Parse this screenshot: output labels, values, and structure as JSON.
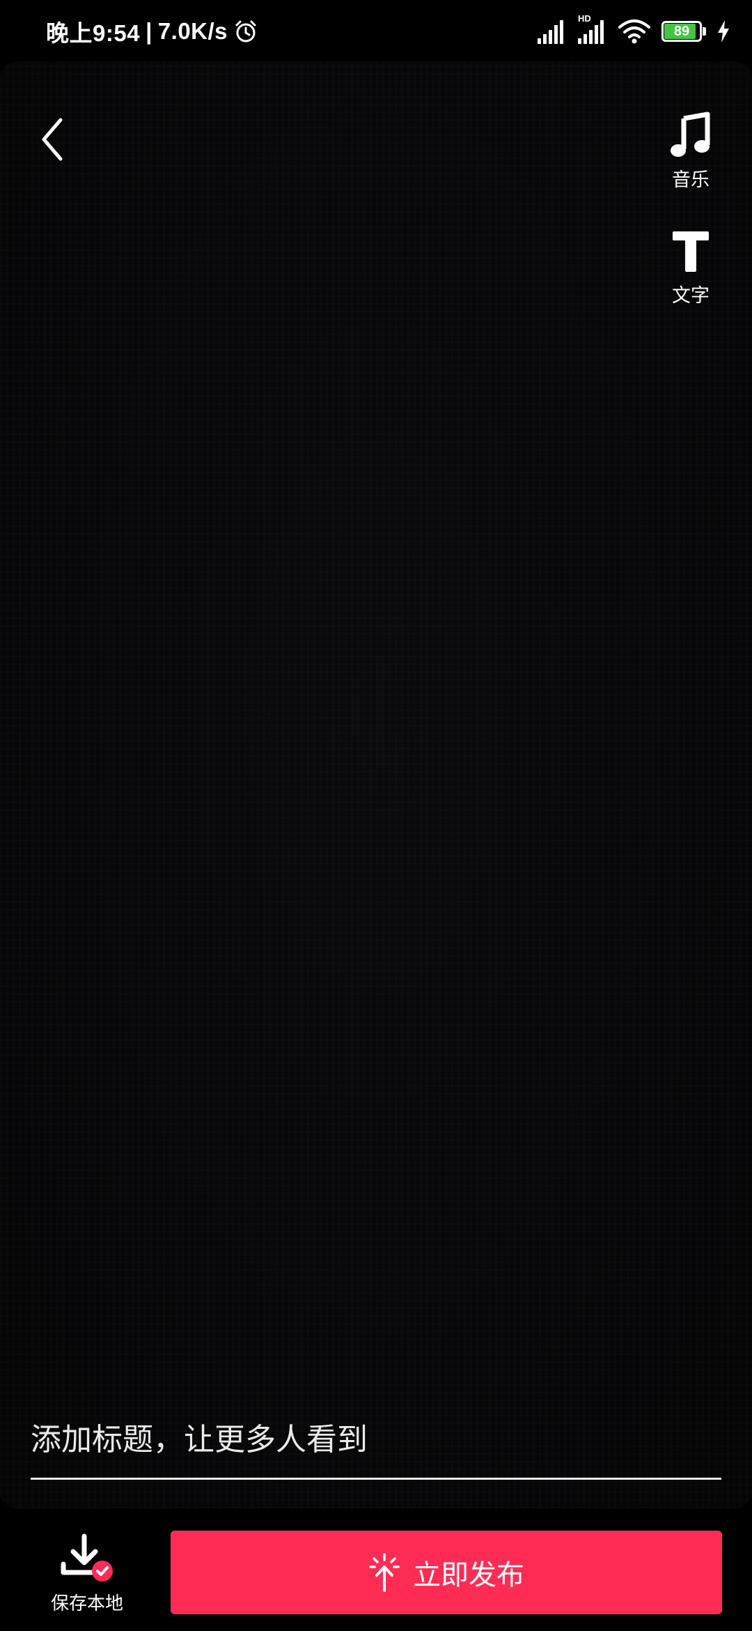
{
  "status_bar": {
    "time": "晚上9:54",
    "network_speed": "7.0K/s",
    "separator": "|",
    "hd_label": "HD",
    "battery_level": "89",
    "battery_fraction": 0.89,
    "battery_color": "#45c345"
  },
  "toolbar": {
    "back_icon": "chevron-left-icon",
    "music_label": "音乐",
    "text_label": "文字"
  },
  "caption": {
    "placeholder": "添加标题，让更多人看到",
    "value": ""
  },
  "bottom_bar": {
    "save_label": "保存本地",
    "publish_label": "立即发布",
    "publish_color": "#fe2c55"
  }
}
